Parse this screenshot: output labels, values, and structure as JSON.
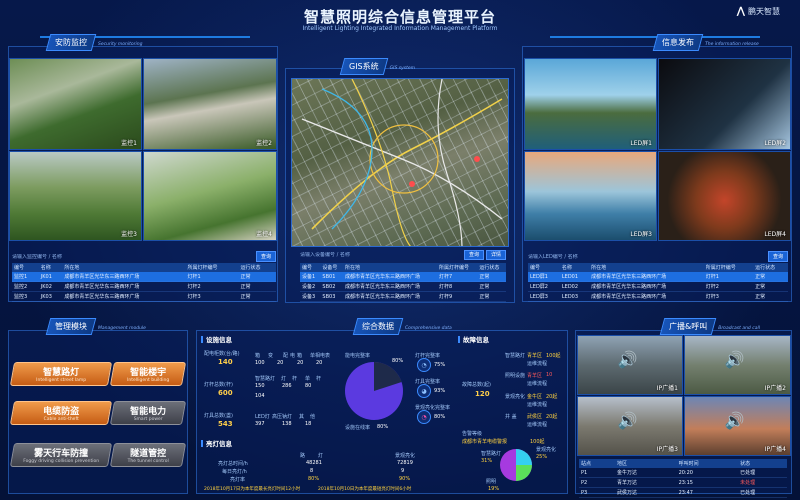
{
  "header": {
    "title": "智慧照明综合信息管理平台",
    "subtitle": "Intelligent Lighting Integrated Information Management Platform",
    "brand": "鹏天智慧"
  },
  "security": {
    "tag": "安防监控",
    "tag_sub": "Security monitoring",
    "cams": [
      "监控1",
      "监控2",
      "监控3",
      "监控4"
    ],
    "search_placeholder": "请输入监控编号 / 名称",
    "search_label": "查询",
    "columns": [
      "编号",
      "名称",
      "所在地",
      "所属灯杆编号",
      "运行状态"
    ],
    "rows": [
      [
        "监控1",
        "JK01",
        "成都市青羊区光华东三路西环广场",
        "灯杆1",
        "正常"
      ],
      [
        "监控2",
        "JK02",
        "成都市青羊区光华东三路西环广场",
        "灯杆2",
        "正常"
      ],
      [
        "监控3",
        "JK03",
        "成都市青羊区光华东三路西环广场",
        "灯杆3",
        "正常"
      ]
    ]
  },
  "gis": {
    "tag": "GIS系统",
    "tag_sub": "GIS system",
    "search_placeholder": "请输入设备编号 / 名称",
    "search_label": "查询",
    "detail_label": "详情",
    "columns": [
      "编号",
      "设备号",
      "所在地",
      "所属灯杆编号",
      "运行状态"
    ],
    "rows": [
      [
        "设备1",
        "SB01",
        "成都市青羊区光华东三路西环广场",
        "灯杆7",
        "正常"
      ],
      [
        "设备2",
        "SB02",
        "成都市青羊区光华东三路西环广场",
        "灯杆8",
        "正常"
      ],
      [
        "设备3",
        "SB03",
        "成都市青羊区光华东三路西环广场",
        "灯杆9",
        "正常"
      ]
    ]
  },
  "info": {
    "tag": "信息发布",
    "tag_sub": "The information release",
    "screens": [
      "LED屏1",
      "LED屏2",
      "LED屏3",
      "LED屏4"
    ],
    "search_placeholder": "请输入LED编号 / 名称",
    "search_label": "查询",
    "columns": [
      "编号",
      "名称",
      "所在地",
      "所属灯杆编号",
      "运行状态"
    ],
    "rows": [
      [
        "LED屏1",
        "LED01",
        "成都市青羊区光华东三路西环广场",
        "灯杆1",
        "正常"
      ],
      [
        "LED屏2",
        "LED02",
        "成都市青羊区光华东三路西环广场",
        "灯杆2",
        "正常"
      ],
      [
        "LED屏3",
        "LED03",
        "成都市青羊区光华东三路西环广场",
        "灯杆3",
        "正常"
      ]
    ]
  },
  "modules": {
    "tag": "管理模块",
    "tag_sub": "Management module",
    "items": [
      {
        "cn": "智慧路灯",
        "en": "Intelligent street lamp",
        "active": true
      },
      {
        "cn": "智能楼宇",
        "en": "Intelligent building",
        "active": true
      },
      {
        "cn": "电缆防盗",
        "en": "Cable anti-theft",
        "active": true
      },
      {
        "cn": "智能电力",
        "en": "Smart power",
        "active": false
      },
      {
        "cn": "雾天行车防撞",
        "en": "Foggy driving collision prevention",
        "active": false
      },
      {
        "cn": "隧道管控",
        "en": "The tunnel control",
        "active": false
      }
    ]
  },
  "data": {
    "tag": "综合数据",
    "tag_sub": "Comprehensive data",
    "facility": {
      "title": "设施信息",
      "items": [
        {
          "label": "配电柜数(台/路)",
          "value": "140"
        },
        {
          "label": "灯杆总数(杆)",
          "value": "600"
        },
        {
          "label": "灯具总数(盏)",
          "value": "543"
        }
      ],
      "row1_heads": [
        "箱",
        "变",
        "配",
        "电",
        "箱",
        "单相电表"
      ],
      "row1_vals": [
        "100",
        "20",
        "20",
        "20"
      ],
      "row2_heads": [
        "智慧路灯",
        "灯",
        "杆",
        "单",
        "杆"
      ],
      "row2_vals": [
        "150",
        "286",
        "80",
        "104"
      ],
      "row3_heads": [
        "LED灯",
        "高压钠灯",
        "其",
        "他"
      ],
      "row3_vals": [
        "397",
        "138",
        "18"
      ]
    },
    "energy": {
      "title": "亮灯信息",
      "heads": [
        "路",
        "灯",
        "景观亮化"
      ],
      "rows": [
        {
          "label": "亮灯总时间/h",
          "v1": "48281",
          "v2": "72819"
        },
        {
          "label": "每日亮灯/h",
          "v1": "8",
          "v2": "9"
        },
        {
          "label": "亮灯率",
          "v1": "80%",
          "v2": "90%"
        }
      ],
      "note1": "2018年10月17日为本年度最长亮灯时间12小时",
      "note2": "2018年10月10日为本年度最短亮灯时间6小时"
    },
    "rates": {
      "pie_label": "能电完整率",
      "pie_value": "80%",
      "online_label": "设施在线率",
      "online_value": "80%",
      "items": [
        {
          "label": "灯杆完整率",
          "value": "75%"
        },
        {
          "label": "灯具完整率",
          "value": "93%"
        },
        {
          "label": "景观亮化完整率",
          "value": "80%"
        }
      ]
    },
    "fault": {
      "title": "故障信息",
      "total_label": "故障总数(起)",
      "total": "120",
      "items": [
        {
          "label": "智慧路灯",
          "loc": "青羊区",
          "count": "100起",
          "status": "运维流程"
        },
        {
          "label": "照明设施",
          "loc": "青羊区",
          "count": "10",
          "status": "运维流程"
        },
        {
          "label": "景观亮化",
          "loc": "金牛区",
          "count": "20起",
          "status": "运维流程"
        },
        {
          "label": "井 盖",
          "loc": "武侯区",
          "count": "20起",
          "status": "运维流程"
        }
      ],
      "warn_title": "告警等级",
      "warn_loc": "成都市青羊电缆警报",
      "warn_count": "100起",
      "warn_pie": [
        {
          "label": "智慧路灯",
          "value": "31%"
        },
        {
          "label": "景观亮化",
          "value": "25%"
        },
        {
          "label": "照明",
          "value": "19%"
        }
      ]
    }
  },
  "broadcast": {
    "tag": "广播&呼叫",
    "tag_sub": "Broadcast and call",
    "cams": [
      "IP广播1",
      "IP广播2",
      "IP广播3",
      "IP广播4"
    ],
    "columns": [
      "站点",
      "地区",
      "呼叫时间",
      "状态"
    ],
    "rows": [
      [
        "P1",
        "金牛万达",
        "20:20",
        "已处理"
      ],
      [
        "P2",
        "青羊万达",
        "23:15",
        "未处理"
      ],
      [
        "P3",
        "武侯万达",
        "23:47",
        "已处理"
      ]
    ],
    "status_colors": {
      "ok": "#ffffff",
      "pending": "#ff5a5a"
    }
  },
  "colors": {
    "accent": "#1e7be0",
    "module_active": "#e07a2a",
    "module_inactive": "#55585f",
    "gold": "#ffd23f"
  }
}
